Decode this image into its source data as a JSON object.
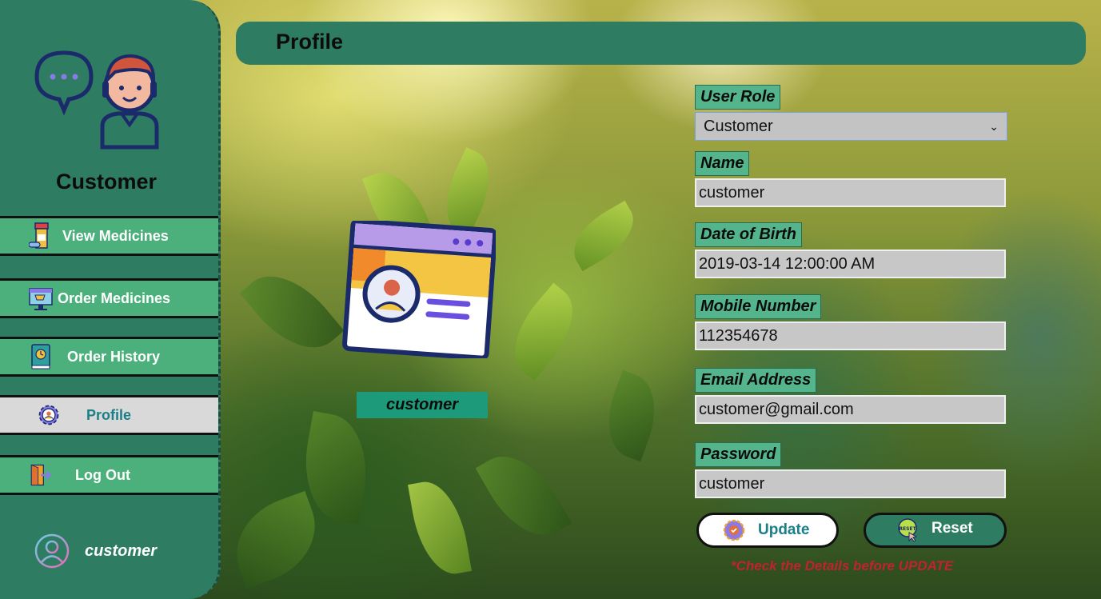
{
  "sidebar": {
    "role_title": "Customer",
    "items": [
      {
        "label": "View Medicines",
        "icon": "medicine-bottle-icon"
      },
      {
        "label": "Order Medicines",
        "icon": "shopping-cart-monitor-icon"
      },
      {
        "label": "Order History",
        "icon": "history-book-icon"
      },
      {
        "label": "Profile",
        "icon": "gear-user-icon",
        "active": true
      },
      {
        "label": "Log Out",
        "icon": "logout-door-icon"
      }
    ],
    "footer_username": "customer"
  },
  "header": {
    "title": "Profile"
  },
  "profile": {
    "display_name": "customer"
  },
  "form": {
    "user_role": {
      "label": "User Role",
      "value": "Customer"
    },
    "name": {
      "label": "Name",
      "value": "customer"
    },
    "dob": {
      "label": "Date of Birth",
      "value": "2019-03-14 12:00:00 AM"
    },
    "mobile": {
      "label": "Mobile Number",
      "value": "112354678"
    },
    "email": {
      "label": "Email Address",
      "value": "customer@gmail.com"
    },
    "password": {
      "label": "Password",
      "value": "customer"
    }
  },
  "actions": {
    "update_label": "Update",
    "reset_label": "Reset"
  },
  "note": "*Check the Details before UPDATE",
  "colors": {
    "sidebar": "#2e7d62",
    "nav_item": "#4cb07c",
    "label_bg": "#54b58c",
    "note": "#c0232e",
    "accent_text": "#1a7f86"
  }
}
